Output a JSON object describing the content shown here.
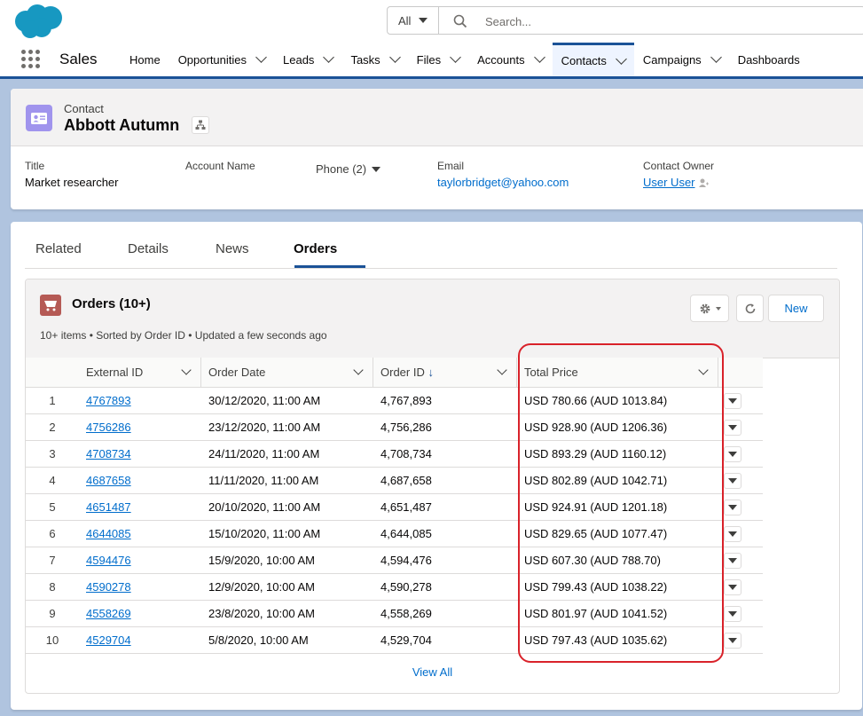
{
  "header": {
    "search_scope": "All",
    "search_placeholder": "Search...",
    "app_name": "Sales",
    "nav": [
      {
        "label": "Home",
        "dropdown": false
      },
      {
        "label": "Opportunities",
        "dropdown": true
      },
      {
        "label": "Leads",
        "dropdown": true
      },
      {
        "label": "Tasks",
        "dropdown": true
      },
      {
        "label": "Files",
        "dropdown": true
      },
      {
        "label": "Accounts",
        "dropdown": true
      },
      {
        "label": "Contacts",
        "dropdown": true,
        "active": true
      },
      {
        "label": "Campaigns",
        "dropdown": true
      },
      {
        "label": "Dashboards",
        "dropdown": false
      }
    ]
  },
  "record": {
    "type": "Contact",
    "name": "Abbott Autumn",
    "fields": {
      "title_label": "Title",
      "title_value": "Market researcher",
      "account_label": "Account Name",
      "phone_label": "Phone (2)",
      "email_label": "Email",
      "email_value": "taylorbridget@yahoo.com",
      "owner_label": "Contact Owner",
      "owner_value": "User User"
    }
  },
  "tabs": [
    "Related",
    "Details",
    "News",
    "Orders"
  ],
  "active_tab": "Orders",
  "orders": {
    "title": "Orders (10+)",
    "subtitle": "10+ items • Sorted by Order ID • Updated a few seconds ago",
    "new_label": "New",
    "columns": [
      "External ID",
      "Order Date",
      "Order ID",
      "Total Price"
    ],
    "sort_arrow": "↓",
    "rows": [
      {
        "n": "1",
        "ext": "4767893",
        "date": "30/12/2020, 11:00 AM",
        "id": "4,767,893",
        "price": "USD 780.66 (AUD 1013.84)"
      },
      {
        "n": "2",
        "ext": "4756286",
        "date": "23/12/2020, 11:00 AM",
        "id": "4,756,286",
        "price": "USD 928.90 (AUD 1206.36)"
      },
      {
        "n": "3",
        "ext": "4708734",
        "date": "24/11/2020, 11:00 AM",
        "id": "4,708,734",
        "price": "USD 893.29 (AUD 1160.12)"
      },
      {
        "n": "4",
        "ext": "4687658",
        "date": "11/11/2020, 11:00 AM",
        "id": "4,687,658",
        "price": "USD 802.89 (AUD 1042.71)"
      },
      {
        "n": "5",
        "ext": "4651487",
        "date": "20/10/2020, 11:00 AM",
        "id": "4,651,487",
        "price": "USD 924.91 (AUD 1201.18)"
      },
      {
        "n": "6",
        "ext": "4644085",
        "date": "15/10/2020, 11:00 AM",
        "id": "4,644,085",
        "price": "USD 829.65 (AUD 1077.47)"
      },
      {
        "n": "7",
        "ext": "4594476",
        "date": "15/9/2020, 10:00 AM",
        "id": "4,594,476",
        "price": "USD 607.30 (AUD 788.70)"
      },
      {
        "n": "8",
        "ext": "4590278",
        "date": "12/9/2020, 10:00 AM",
        "id": "4,590,278",
        "price": "USD 799.43 (AUD 1038.22)"
      },
      {
        "n": "9",
        "ext": "4558269",
        "date": "23/8/2020, 10:00 AM",
        "id": "4,558,269",
        "price": "USD 801.97 (AUD 1041.52)"
      },
      {
        "n": "10",
        "ext": "4529704",
        "date": "5/8/2020, 10:00 AM",
        "id": "4,529,704",
        "price": "USD 797.43 (AUD 1035.62)"
      }
    ],
    "view_all": "View All"
  },
  "colors": {
    "brand_blue": "#1b5297",
    "link": "#006dcc",
    "contact_icon": "#a094ed",
    "orders_icon": "#b55a55",
    "highlight": "#d9222a"
  }
}
